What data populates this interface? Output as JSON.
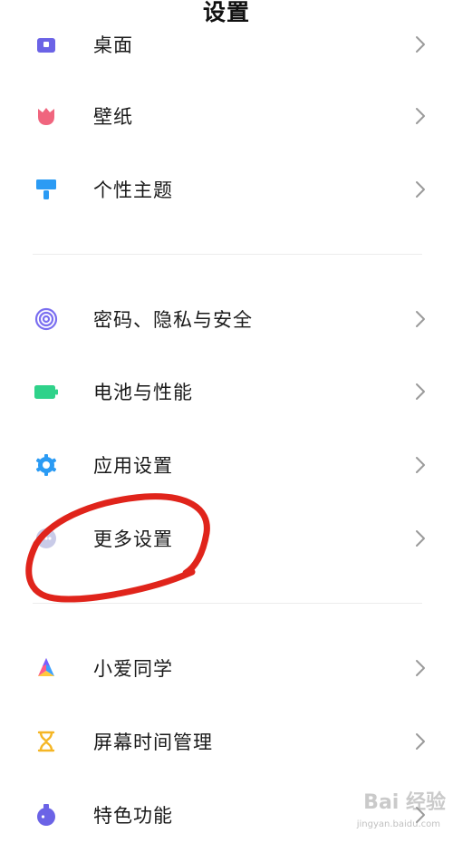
{
  "header": {
    "title": "设置"
  },
  "colors": {
    "annotation_red": "#e0241b",
    "divider": "#ececec",
    "chevron": "#9a9a9a"
  },
  "groups": [
    {
      "items": [
        {
          "label": "桌面",
          "icon": "desktop-icon"
        },
        {
          "label": "壁纸",
          "icon": "tulip-icon"
        },
        {
          "label": "个性主题",
          "icon": "paint-brush-icon"
        }
      ]
    },
    {
      "items": [
        {
          "label": "密码、隐私与安全",
          "icon": "fingerprint-icon"
        },
        {
          "label": "电池与性能",
          "icon": "battery-icon"
        },
        {
          "label": "应用设置",
          "icon": "gear-icon"
        },
        {
          "label": "更多设置",
          "icon": "more-dots-icon"
        }
      ]
    },
    {
      "items": [
        {
          "label": "小爱同学",
          "icon": "xiaoai-icon"
        },
        {
          "label": "屏幕时间管理",
          "icon": "hourglass-icon"
        },
        {
          "label": "特色功能",
          "icon": "flask-icon"
        }
      ]
    }
  ],
  "watermark": {
    "logo": "Bai 经验",
    "sub": "jingyan.baidu.com"
  }
}
